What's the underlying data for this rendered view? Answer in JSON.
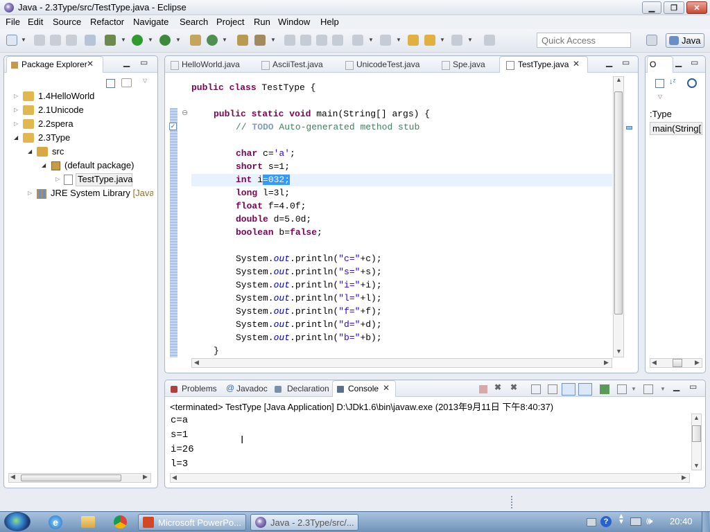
{
  "window": {
    "title": "Java - 2.3Type/src/TestType.java - Eclipse"
  },
  "menu": [
    "File",
    "Edit",
    "Source",
    "Refactor",
    "Navigate",
    "Search",
    "Project",
    "Run",
    "Window",
    "Help"
  ],
  "toolbar": {
    "quick_access_placeholder": "Quick Access",
    "perspective": "Java"
  },
  "package_explorer": {
    "title": "Package Explorer",
    "items": [
      {
        "label": "1.4HelloWorld"
      },
      {
        "label": "2.1Unicode"
      },
      {
        "label": "2.2spera"
      },
      {
        "label": "2.3Type"
      },
      {
        "label": "src"
      },
      {
        "label": "(default package)"
      },
      {
        "label": "TestType.java"
      },
      {
        "label": "JRE System Library",
        "suffix": "[JavaS"
      }
    ]
  },
  "editor": {
    "tabs": [
      "HelloWorld.java",
      "AsciiTest.java",
      "UnicodeTest.java",
      "Spe.java",
      "TestType.java"
    ],
    "active_tab": "TestType.java",
    "lines": {
      "class_kw": "public class ",
      "class_name": "TestType {",
      "main_kw": "public static void ",
      "main_sig": "main(String[] args) {",
      "comment_pre": "// ",
      "comment_todo": "TODO",
      "comment_post": " Auto-generated method stub",
      "char_kw": "char ",
      "char_rest": "c=",
      "char_val": "'a'",
      "char_end": ";",
      "short_kw": "short ",
      "short_rest": "s=1;",
      "int_kw": "int ",
      "int_var": "i",
      "int_sel": "=032;",
      "long_kw": "long ",
      "long_rest": "l=3l;",
      "float_kw": "float ",
      "float_rest": "f=4.0f;",
      "double_kw": "double ",
      "double_rest": "d=5.0d;",
      "boolean_kw": "boolean ",
      "boolean_rest": "b=",
      "boolean_val": "false",
      "boolean_end": ";",
      "print_pre": "System.",
      "print_out": "out",
      "print_mid": ".println(",
      "prints": [
        {
          "str": "\"c=\"",
          "rest": "+c);"
        },
        {
          "str": "\"s=\"",
          "rest": "+s);"
        },
        {
          "str": "\"i=\"",
          "rest": "+i);"
        },
        {
          "str": "\"l=\"",
          "rest": "+l);"
        },
        {
          "str": "\"f=\"",
          "rest": "+f);"
        },
        {
          "str": "\"d=\"",
          "rest": "+d);"
        },
        {
          "str": "\"b=\"",
          "rest": "+b);"
        }
      ],
      "close_brace": "}"
    }
  },
  "outline": {
    "tab_label": "O",
    "type_label": ":Type",
    "method_label": "main(String["
  },
  "bottom_panel": {
    "tabs": [
      "Problems",
      "Javadoc",
      "Declaration",
      "Console"
    ],
    "active_tab": "Console",
    "status": "<terminated> TestType [Java Application] D:\\JDk1.6\\bin\\javaw.exe (2013年9月11日 下午8:40:37)",
    "output": [
      "c=a",
      "s=1",
      "i=26",
      "l=3"
    ]
  },
  "taskbar": {
    "items": [
      "Microsoft PowerPo...",
      "Java - 2.3Type/src/..."
    ],
    "clock": "20:40"
  },
  "colors": {
    "keyword": "#7f0055",
    "string": "#2a00ff",
    "comment": "#3f7f5f",
    "selection": "#3399ff",
    "highlight_line": "#e8f2fe"
  }
}
